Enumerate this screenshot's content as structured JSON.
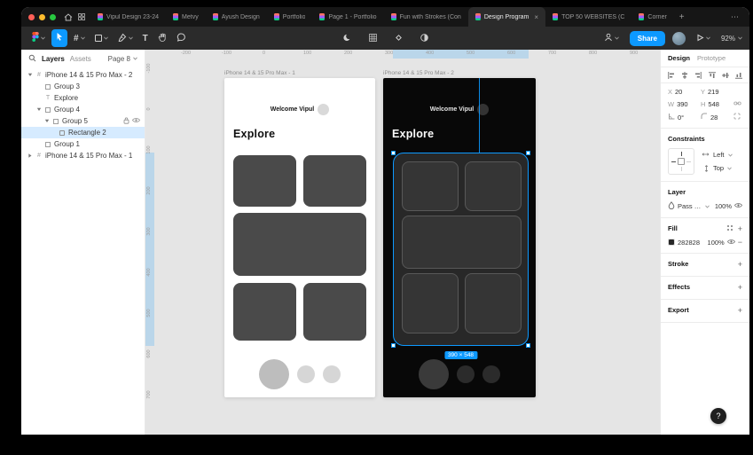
{
  "icons": {
    "frame": "#",
    "text": "T",
    "plus": "+",
    "minus": "−",
    "close": "×",
    "ellipsis": "⋯",
    "help": "?"
  },
  "tabbar": {
    "tabs": [
      {
        "label": "Vipul Design 23-24"
      },
      {
        "label": "Metvy"
      },
      {
        "label": "Ayush Design"
      },
      {
        "label": "Portfolio"
      },
      {
        "label": "Page 1 - Portfolio"
      },
      {
        "label": "Fun with Strokes (Con"
      },
      {
        "label": "Design Program"
      },
      {
        "label": "TOP 50 WEBSITES (C"
      },
      {
        "label": "Corner"
      }
    ]
  },
  "toolbar": {
    "share_label": "Share",
    "zoom_label": "92%"
  },
  "layers_panel": {
    "layers_tab": "Layers",
    "assets_tab": "Assets",
    "page_label": "Page 8",
    "items": [
      {
        "label": "iPhone 14 & 15 Pro Max - 2"
      },
      {
        "label": "Group 3"
      },
      {
        "label": "Explore"
      },
      {
        "label": "Group 4"
      },
      {
        "label": "Group 5"
      },
      {
        "label": "Rectangle 2"
      },
      {
        "label": "Group 1"
      },
      {
        "label": "iPhone 14 & 15 Pro Max - 1"
      }
    ]
  },
  "canvas": {
    "frame1": {
      "label": "iPhone 14 & 15 Pro Max - 1",
      "welcome": "Welcome Vipul",
      "heading": "Explore"
    },
    "frame2": {
      "label": "iPhone 14 & 15 Pro Max - 2",
      "welcome": "Welcome Vipul",
      "heading": "Explore"
    },
    "selection_badge": "390 × 548",
    "ruler_top": [
      "-200",
      "-100",
      "0",
      "100",
      "200",
      "300",
      "400",
      "500",
      "600",
      "700",
      "800",
      "900"
    ],
    "ruler_left": [
      "-100",
      "0",
      "100",
      "200",
      "300",
      "400",
      "500",
      "600",
      "700"
    ]
  },
  "design_panel": {
    "design_tab": "Design",
    "prototype_tab": "Prototype",
    "position": {
      "x_label": "X",
      "x": "20",
      "y_label": "Y",
      "y": "219",
      "w_label": "W",
      "w": "390",
      "h_label": "H",
      "h": "548",
      "angle": "0°",
      "radius": "28"
    },
    "constraints": {
      "title": "Constraints",
      "horizontal": "Left",
      "vertical": "Top"
    },
    "layer": {
      "title": "Layer",
      "blend_mode": "Pass through",
      "opacity": "100%"
    },
    "fill": {
      "title": "Fill",
      "hex": "282828",
      "opacity": "100%"
    },
    "stroke": {
      "title": "Stroke"
    },
    "effects": {
      "title": "Effects"
    },
    "export": {
      "title": "Export"
    }
  },
  "colors": {
    "accent": "#0d99ff",
    "selected_fill": "#282828",
    "canvas_bg": "#e5e5e5"
  }
}
